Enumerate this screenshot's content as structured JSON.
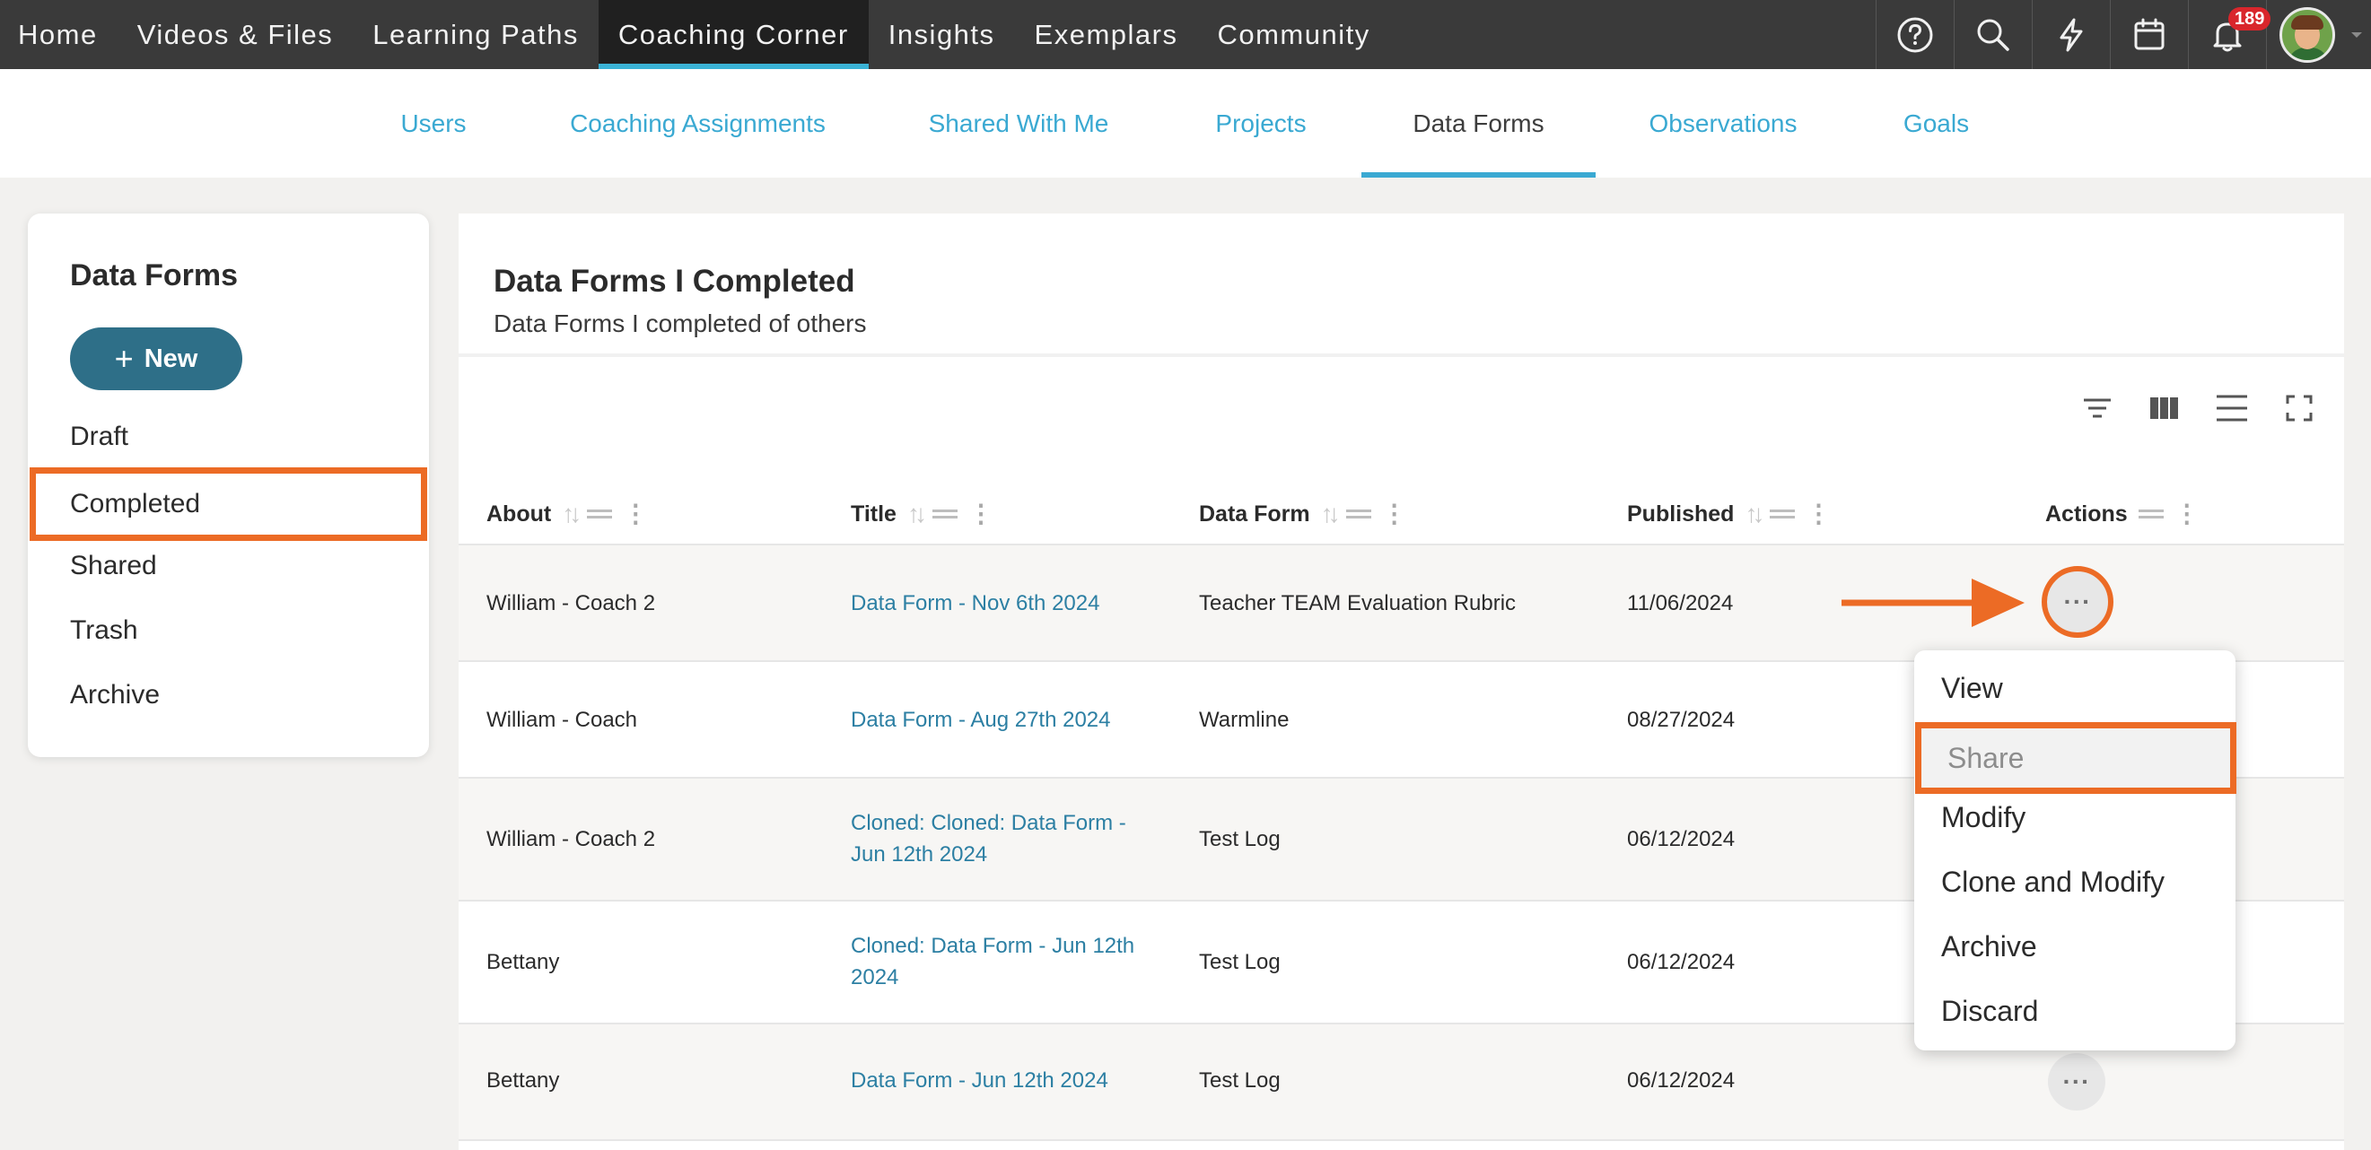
{
  "topnav": {
    "items": [
      {
        "label": "Home"
      },
      {
        "label": "Videos & Files"
      },
      {
        "label": "Learning Paths"
      },
      {
        "label": "Coaching Corner"
      },
      {
        "label": "Insights"
      },
      {
        "label": "Exemplars"
      },
      {
        "label": "Community"
      }
    ],
    "active_index": 3,
    "icons": [
      "help-icon",
      "search-icon",
      "lightning-icon",
      "calendar-icon",
      "bell-icon"
    ],
    "notification_count": "189"
  },
  "subnav": {
    "tabs": [
      {
        "label": "Users"
      },
      {
        "label": "Coaching Assignments"
      },
      {
        "label": "Shared With Me"
      },
      {
        "label": "Projects"
      },
      {
        "label": "Data Forms"
      },
      {
        "label": "Observations"
      },
      {
        "label": "Goals"
      }
    ],
    "active_index": 4
  },
  "sidebar": {
    "title": "Data Forms",
    "new_button": "New",
    "items": [
      {
        "label": "Draft"
      },
      {
        "label": "Completed"
      },
      {
        "label": "Shared"
      },
      {
        "label": "Trash"
      },
      {
        "label": "Archive"
      }
    ],
    "selected_index": 1
  },
  "main": {
    "title": "Data Forms I Completed",
    "subtitle": "Data Forms I completed of others",
    "toolbar_icons": [
      "filter-icon",
      "columns-icon",
      "density-icon",
      "fullscreen-icon"
    ],
    "columns": [
      {
        "label": "About"
      },
      {
        "label": "Title"
      },
      {
        "label": "Data Form"
      },
      {
        "label": "Published"
      },
      {
        "label": "Actions"
      }
    ],
    "rows": [
      {
        "about": "William - Coach 2",
        "title_line1": "Data Form - Nov 6th 2024",
        "title_line2": "",
        "form": "Teacher TEAM Evaluation Rubric",
        "published": "11/06/2024"
      },
      {
        "about": "William - Coach",
        "title_line1": "Data Form - Aug 27th 2024",
        "title_line2": "",
        "form": "Warmline",
        "published": "08/27/2024"
      },
      {
        "about": "William - Coach 2",
        "title_line1": "Cloned: Cloned: Data Form -",
        "title_line2": "Jun 12th 2024",
        "form": "Test Log",
        "published": "06/12/2024"
      },
      {
        "about": "Bettany",
        "title_line1": "Cloned: Data Form - Jun 12th",
        "title_line2": "2024",
        "form": "Test Log",
        "published": "06/12/2024"
      },
      {
        "about": "Bettany",
        "title_line1": "Data Form - Jun 12th 2024",
        "title_line2": "",
        "form": "Test Log",
        "published": "06/12/2024"
      }
    ],
    "actions_glyph": "···"
  },
  "action_menu": {
    "items": [
      {
        "label": "View"
      },
      {
        "label": "Share"
      },
      {
        "label": "Modify"
      },
      {
        "label": "Clone and Modify"
      },
      {
        "label": "Archive"
      },
      {
        "label": "Discard"
      }
    ],
    "highlighted_index": 1
  },
  "colors": {
    "nav_bg": "#3a3a3a",
    "accent": "#3aa9d2",
    "link": "#2c7fa3",
    "button": "#2e6f88",
    "highlight": "#ec6b25",
    "badge": "#d9262c"
  }
}
